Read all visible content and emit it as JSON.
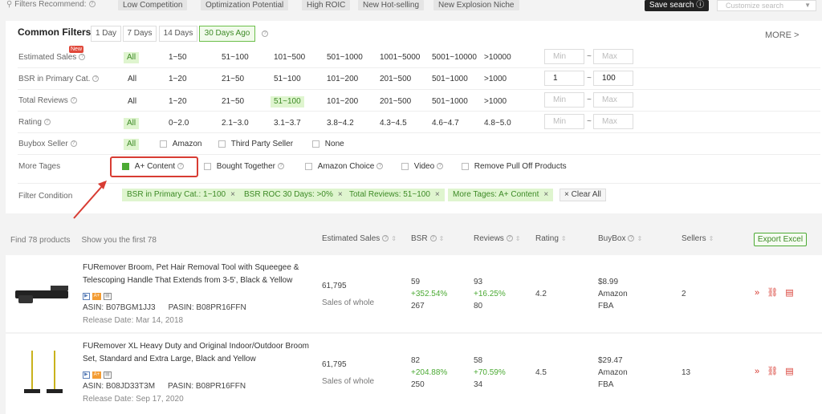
{
  "recommend": {
    "label": "Filters Recommend:",
    "chips": [
      "Low Competition",
      "Optimization Potential",
      "High ROIC",
      "New Hot-selling",
      "New Explosion Niche"
    ],
    "save_search": "Save search",
    "customize_placeholder": "Customize search"
  },
  "common_filters": {
    "title": "Common Filters",
    "tabs": [
      "1 Day",
      "7 Days",
      "14 Days",
      "30 Days Ago"
    ],
    "active_tab": "30 Days Ago",
    "more": "MORE >",
    "new_badge": "New",
    "rows": [
      {
        "label": "Estimated Sales",
        "options": [
          "All",
          "1~50",
          "51~100",
          "101~500",
          "501~1000",
          "1001~5000",
          "5001~10000",
          ">10000"
        ],
        "selected": "All",
        "min": "Min",
        "max": "Max"
      },
      {
        "label": "BSR in Primary Cat.",
        "options": [
          "All",
          "1~20",
          "21~50",
          "51~100",
          "101~200",
          "201~500",
          "501~1000",
          ">1000"
        ],
        "selected": "",
        "min": "1",
        "max": "100"
      },
      {
        "label": "Total Reviews",
        "options": [
          "All",
          "1~20",
          "21~50",
          "51~100",
          "101~200",
          "201~500",
          "501~1000",
          ">1000"
        ],
        "selected": "51~100",
        "min": "Min",
        "max": "Max"
      },
      {
        "label": "Rating",
        "options": [
          "All",
          "0~2.0",
          "2.1~3.0",
          "3.1~3.7",
          "3.8~4.2",
          "4.3~4.5",
          "4.6~4.7",
          "4.8~5.0"
        ],
        "selected": "All",
        "min": "Min",
        "max": "Max"
      }
    ],
    "buybox": {
      "label": "Buybox Seller",
      "all": "All",
      "options": [
        "Amazon",
        "Third Party Seller",
        "None"
      ]
    },
    "more_tags": {
      "label": "More Tages",
      "options": [
        "A+ Content",
        "Bought Together",
        "Amazon Choice",
        "Video",
        "Remove Pull Off Products"
      ],
      "checked": "A+ Content"
    },
    "condition": {
      "label": "Filter Condition",
      "tags": [
        "BSR in Primary Cat.: 1~100",
        "BSR ROC 30 Days: >0%",
        "Total Reviews: 51~100",
        "More Tages: A+ Content"
      ],
      "clear_all": "Clear All"
    }
  },
  "results": {
    "find": "Find 78 products",
    "show": "Show you the first 78",
    "columns": [
      "Estimated Sales",
      "BSR",
      "Reviews",
      "Rating",
      "BuyBox",
      "Sellers"
    ],
    "export": "Export Excel",
    "products": [
      {
        "title": "FURemover Broom, Pet Hair Removal Tool with Squeegee & Telescoping Handle That Extends from 3-5', Black & Yellow",
        "asin": "ASIN: B07BGM1JJ3",
        "pasin": "PASIN: B08PR16FFN",
        "release": "Release Date: Mar 14, 2018",
        "sales": "61,795",
        "sales_note": "Sales of whole",
        "bsr": "59",
        "bsr_change": "+352.54%",
        "bsr_prev": "267",
        "reviews": "93",
        "reviews_change": "+16.25%",
        "reviews_prev": "80",
        "rating": "4.2",
        "price": "$8.99",
        "seller": "Amazon",
        "fulfil": "FBA",
        "sellers": "2"
      },
      {
        "title": "FURemover XL Heavy Duty and Original Indoor/Outdoor Broom Set, Standard and Extra Large, Black and Yellow",
        "asin": "ASIN: B08JD33T3M",
        "pasin": "PASIN: B08PR16FFN",
        "release": "Release Date: Sep 17, 2020",
        "sales": "61,795",
        "sales_note": "Sales of whole",
        "bsr": "82",
        "bsr_change": "+204.88%",
        "bsr_prev": "250",
        "reviews": "58",
        "reviews_change": "+70.59%",
        "reviews_prev": "34",
        "rating": "4.5",
        "price": "$29.47",
        "seller": "Amazon",
        "fulfil": "FBA",
        "sellers": "13"
      }
    ],
    "icon_labels": {
      "video": "▶",
      "aplus": "A+",
      "cal": "▤"
    }
  },
  "colors": {
    "accent_green": "#4caa34",
    "highlight_red": "#d83c33"
  }
}
